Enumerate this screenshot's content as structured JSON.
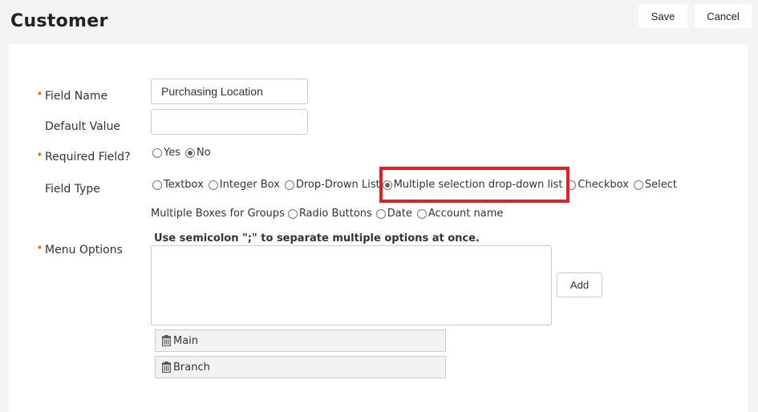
{
  "page": {
    "title": "Customer"
  },
  "toolbar": {
    "save_label": "Save",
    "cancel_label": "Cancel"
  },
  "form": {
    "field_name": {
      "label": "Field Name",
      "value": "Purchasing Location"
    },
    "default_value": {
      "label": "Default Value",
      "value": ""
    },
    "required": {
      "label": "Required Field?",
      "options": [
        "Yes",
        "No"
      ],
      "selected": "No"
    },
    "field_type": {
      "label": "Field Type",
      "options": [
        "Textbox",
        "Integer Box",
        "Drop-Drown List",
        "Multiple selection drop-down list",
        "Checkbox",
        "Select",
        "Multiple Boxes for Groups",
        "Radio Buttons",
        "Date",
        "Account name"
      ],
      "selected": "Multiple selection drop-down list"
    },
    "menu_options": {
      "label": "Menu Options",
      "hint": "Use semicolon \";\" to separate multiple options at once.",
      "add_label": "Add",
      "items": [
        "Main",
        "Branch"
      ]
    }
  },
  "colors": {
    "required_marker": "#e8730c",
    "highlight": "#e01e26"
  }
}
